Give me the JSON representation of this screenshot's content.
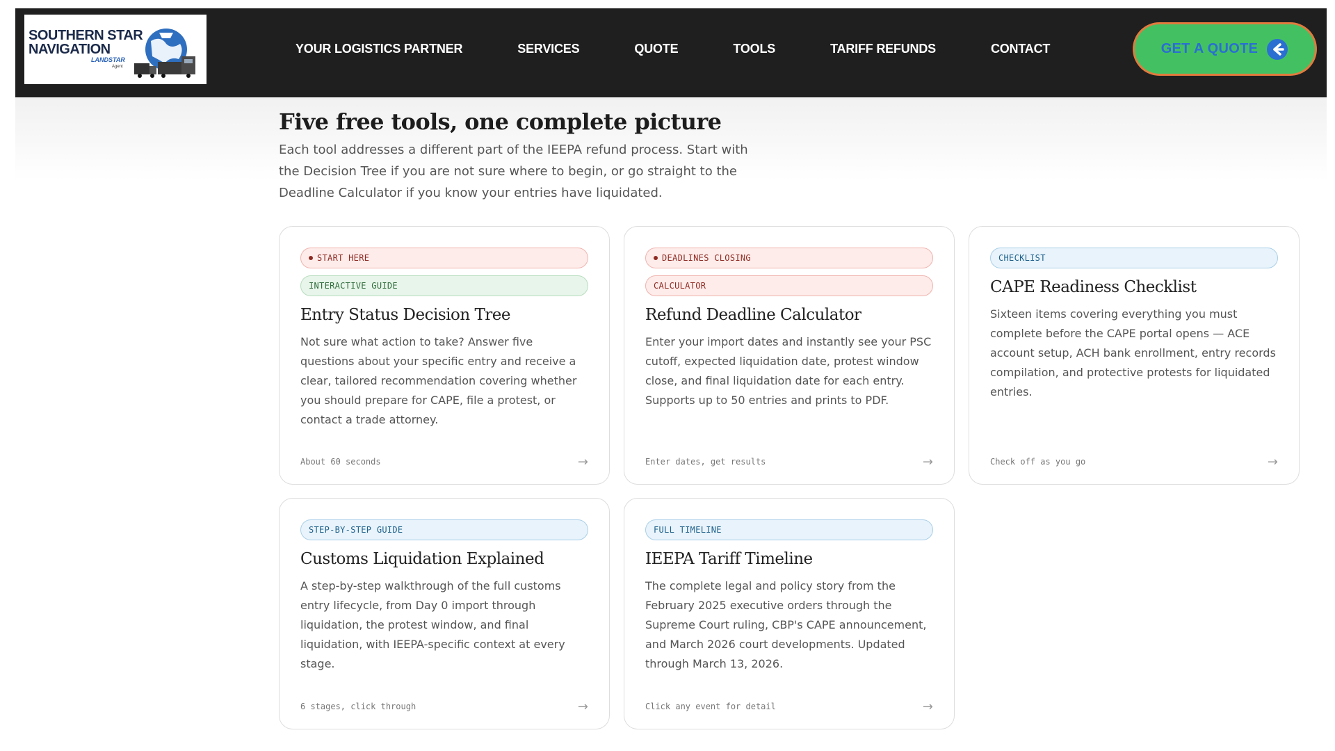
{
  "header": {
    "logo": {
      "line1": "SOUTHERN STAR",
      "line2": "NAVIGATION",
      "sub": "LANDSTAR",
      "sub2": "Agent"
    },
    "nav": [
      {
        "label": "YOUR LOGISTICS PARTNER"
      },
      {
        "label": "SERVICES"
      },
      {
        "label": "QUOTE"
      },
      {
        "label": "TOOLS"
      },
      {
        "label": "TARIFF REFUNDS"
      },
      {
        "label": "CONTACT"
      }
    ],
    "cta_label": "GET A QUOTE",
    "cta_icon": "arrow-left-circle-icon"
  },
  "section": {
    "heading": "Five free tools, one complete picture",
    "intro": "Each tool addresses a different part of the IEEPA refund process. Start with the Decision Tree if you are not sure where to begin, or go straight to the Deadline Calculator if you know your entries have liquidated."
  },
  "cards": [
    {
      "badges": [
        {
          "label": "START HERE",
          "style": "red",
          "dot": true
        },
        {
          "label": "INTERACTIVE GUIDE",
          "style": "green"
        }
      ],
      "title": "Entry Status Decision Tree",
      "description": "Not sure what action to take? Answer five questions about your specific entry and receive a clear, tailored recommendation covering whether you should prepare for CAPE, file a protest, or contact a trade attorney.",
      "footer": "About 60 seconds",
      "arrow": "→"
    },
    {
      "badges": [
        {
          "label": "DEADLINES CLOSING",
          "style": "red",
          "dot": true
        },
        {
          "label": "CALCULATOR",
          "style": "red"
        }
      ],
      "title": "Refund Deadline Calculator",
      "description": "Enter your import dates and instantly see your PSC cutoff, expected liquidation date, protest window close, and final liquidation date for each entry. Supports up to 50 entries and prints to PDF.",
      "footer": "Enter dates, get results",
      "arrow": "→"
    },
    {
      "badges": [
        {
          "label": "CHECKLIST",
          "style": "blue"
        }
      ],
      "title": "CAPE Readiness Checklist",
      "description": "Sixteen items covering everything you must complete before the CAPE portal opens — ACE account setup, ACH bank enrollment, entry records compilation, and protective protests for liquidated entries.",
      "footer": "Check off as you go",
      "arrow": "→"
    },
    {
      "badges": [
        {
          "label": "STEP-BY-STEP GUIDE",
          "style": "blue"
        }
      ],
      "title": "Customs Liquidation Explained",
      "description": "A step-by-step walkthrough of the full customs entry lifecycle, from Day 0 import through liquidation, the protest window, and final liquidation, with IEEPA-specific context at every stage.",
      "footer": "6 stages, click through",
      "arrow": "→"
    },
    {
      "badges": [
        {
          "label": "FULL TIMELINE",
          "style": "blue"
        }
      ],
      "title": "IEEPA Tariff Timeline",
      "description": "The complete legal and policy story from the February 2025 executive orders through the Supreme Court ruling, CBP's CAPE announcement, and March 2026 court developments. Updated through March 13, 2026.",
      "footer": "Click any event for detail",
      "arrow": "→"
    }
  ],
  "colors": {
    "header_bg": "#1f1f1f",
    "cta_bg": "#43c162",
    "cta_border": "#e27a3e",
    "cta_text": "#2a6fd1"
  }
}
